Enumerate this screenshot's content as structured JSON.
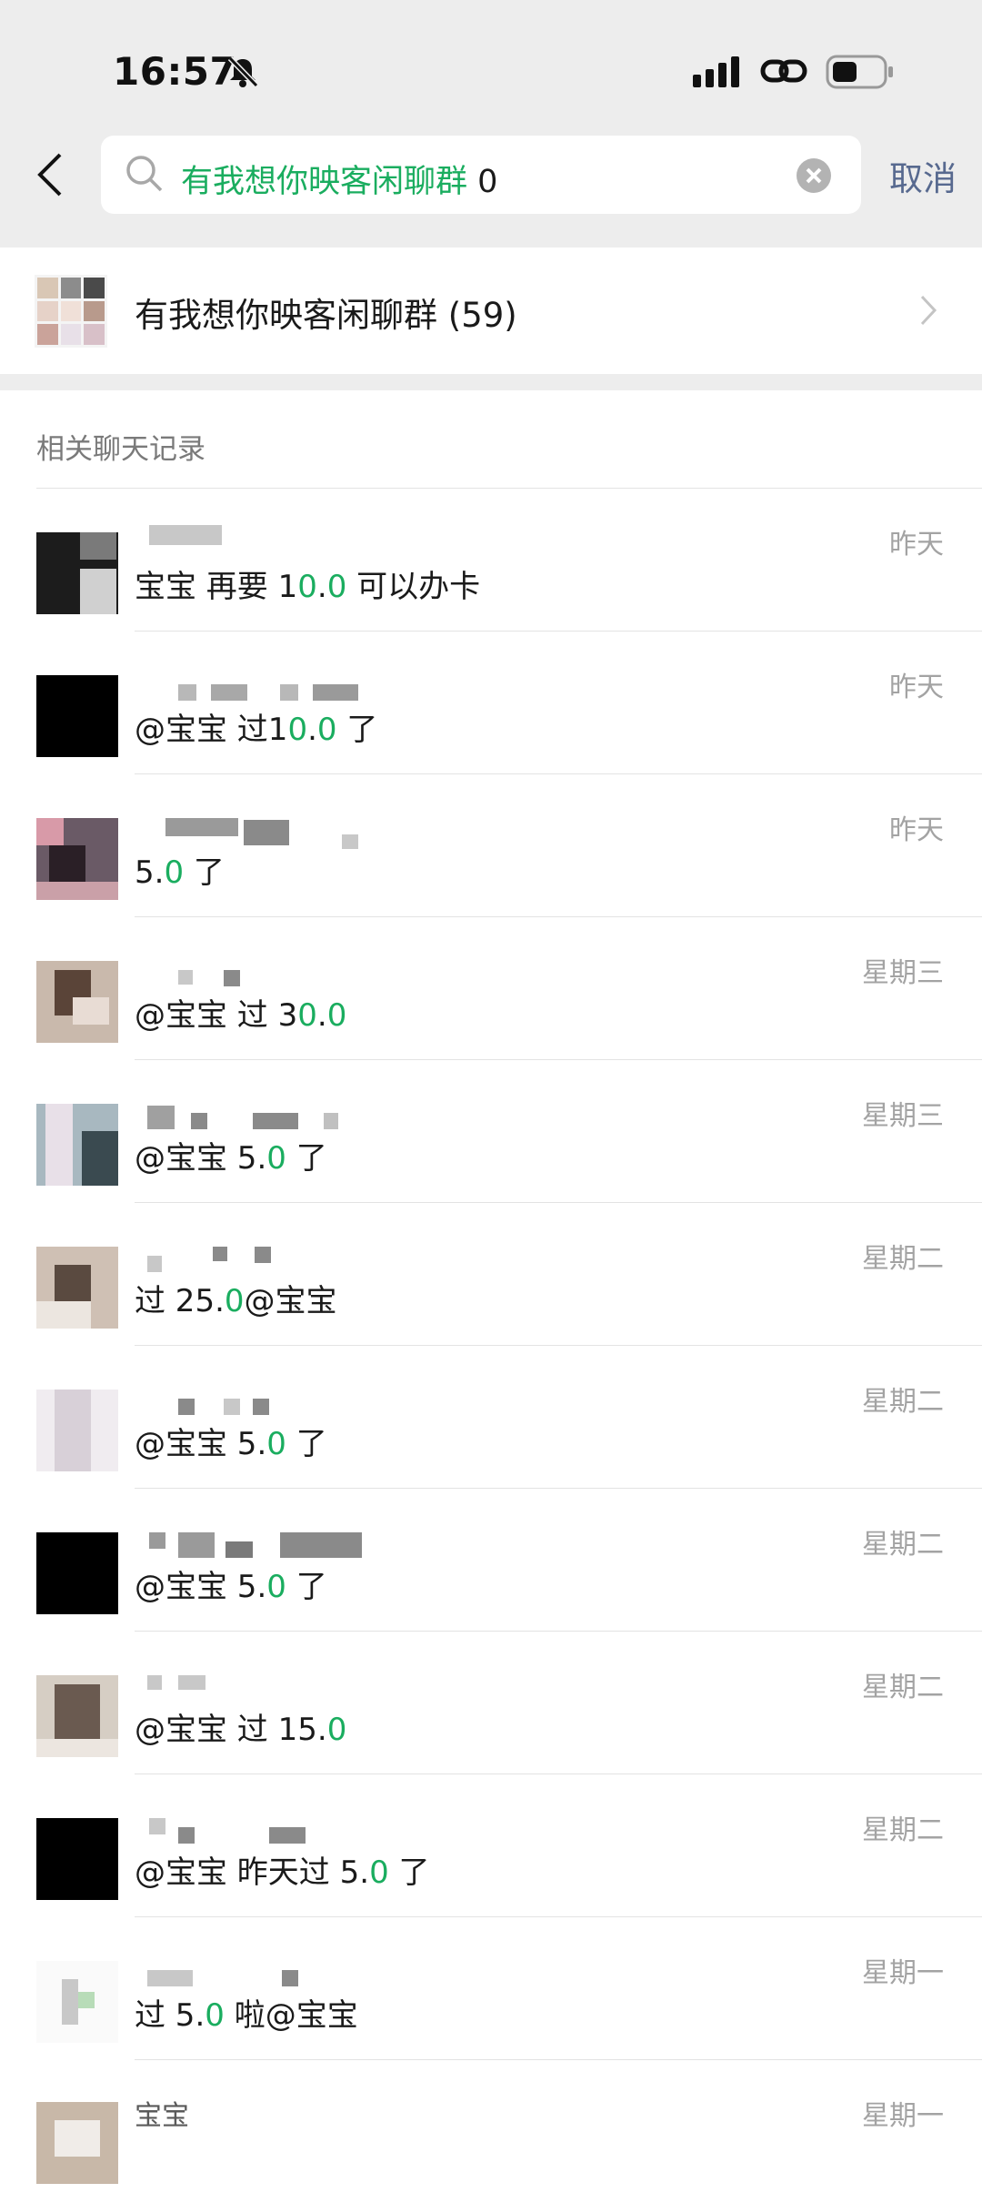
{
  "status_bar": {
    "time": "16:57"
  },
  "search": {
    "query_highlight": "有我想你映客闲聊群",
    "query_rest": " 0",
    "cancel_label": "取消"
  },
  "group": {
    "name": "有我想你映客闲聊群 (59)"
  },
  "section_title": "相关聊天记录",
  "messages": [
    {
      "time": "昨天",
      "pre": "宝宝  再要 1",
      "hl1": "0",
      "mid": ".",
      "hl2": "0",
      "post": " 可以办卡"
    },
    {
      "time": "昨天",
      "pre": "@宝宝 过1",
      "hl1": "0",
      "mid": ".",
      "hl2": "0",
      "post": " 了"
    },
    {
      "time": "昨天",
      "pre": "5.",
      "hl1": "0",
      "mid": "",
      "hl2": "",
      "post": " 了"
    },
    {
      "time": "星期三",
      "pre": "@宝宝 过 3",
      "hl1": "0",
      "mid": ".",
      "hl2": "0",
      "post": ""
    },
    {
      "time": "星期三",
      "pre": "@宝宝 5.",
      "hl1": "0",
      "mid": "",
      "hl2": "",
      "post": " 了"
    },
    {
      "time": "星期二",
      "pre": "过 25.",
      "hl1": "0",
      "mid": "",
      "hl2": "",
      "post": "@宝宝"
    },
    {
      "time": "星期二",
      "pre": "@宝宝 5.",
      "hl1": "0",
      "mid": "",
      "hl2": "",
      "post": " 了"
    },
    {
      "time": "星期二",
      "pre": "@宝宝 5.",
      "hl1": "0",
      "mid": "",
      "hl2": "",
      "post": " 了"
    },
    {
      "time": "星期二",
      "pre": "@宝宝 过 15.",
      "hl1": "0",
      "mid": "",
      "hl2": "",
      "post": ""
    },
    {
      "time": "星期二",
      "pre": "@宝宝 昨天过 5.",
      "hl1": "0",
      "mid": "",
      "hl2": "",
      "post": " 了"
    },
    {
      "time": "星期一",
      "pre": "过 5.",
      "hl1": "0",
      "mid": "",
      "hl2": "",
      "post": " 啦@宝宝"
    }
  ],
  "last_row": {
    "name": "宝宝",
    "time": "星期一"
  },
  "colors": {
    "highlight": "#1aad5f",
    "cancel": "#57698f",
    "header_bg": "#ededed"
  }
}
